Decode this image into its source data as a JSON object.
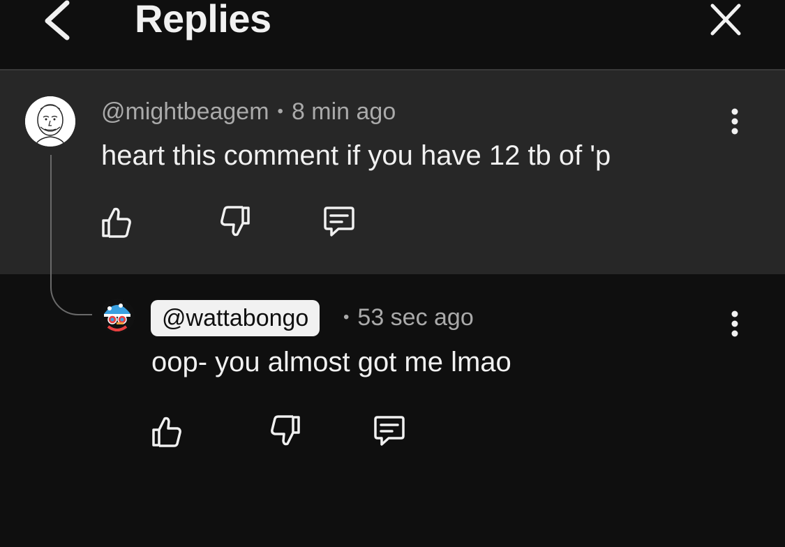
{
  "header": {
    "title": "Replies",
    "back_icon": "chevron-left-icon",
    "close_icon": "close-icon"
  },
  "comment": {
    "author": "@mightbeagem",
    "separator": "•",
    "time": "8 min ago",
    "text": "heart this comment if you have 12 tb of 'p",
    "actions": [
      "thumbs-up-icon",
      "thumbs-down-icon",
      "reply-icon"
    ],
    "menu_icon": "more-vert-icon"
  },
  "reply": {
    "author": "@wattabongo",
    "separator": "•",
    "time": "53 sec ago",
    "text": "oop- you almost got me lmao",
    "actions": [
      "thumbs-up-icon",
      "thumbs-down-icon",
      "reply-icon"
    ],
    "menu_icon": "more-vert-icon"
  },
  "colors": {
    "background": "#0f0f0f",
    "highlight_background": "#272727",
    "text": "#f1f1f1",
    "secondary_text": "#aaaaaa"
  }
}
